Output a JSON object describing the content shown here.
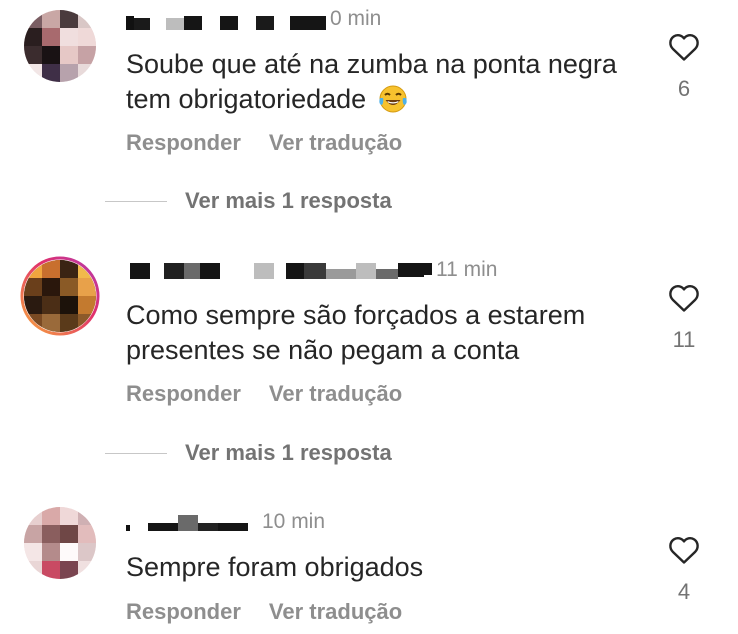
{
  "comments": [
    {
      "time": "0 min",
      "text": "Soube que até na zumba na ponta negra tem obrigatoriedade",
      "emoji": "joy-emoji",
      "reply_label": "Responder",
      "translate_label": "Ver tradução",
      "likes": "6",
      "more_replies": "Ver mais 1 resposta",
      "story_ring": false
    },
    {
      "time": "11 min",
      "text": "Como sempre são forçados a estarem presentes se não pegam a conta",
      "reply_label": "Responder",
      "translate_label": "Ver tradução",
      "likes": "11",
      "more_replies": "Ver mais 1 resposta",
      "story_ring": true
    },
    {
      "time": "10 min",
      "text": "Sempre foram obrigados",
      "reply_label": "Responder",
      "translate_label": "Ver tradução",
      "likes": "4",
      "story_ring": false
    }
  ],
  "colors": {
    "text": "#262626",
    "secondary": "#8e8e8e",
    "heart": "#262626",
    "story_ring_start": "#f58529",
    "story_ring_end": "#c13584"
  },
  "icons": {
    "like": "heart-outline-icon",
    "emoji": "face-with-tears-of-joy"
  }
}
